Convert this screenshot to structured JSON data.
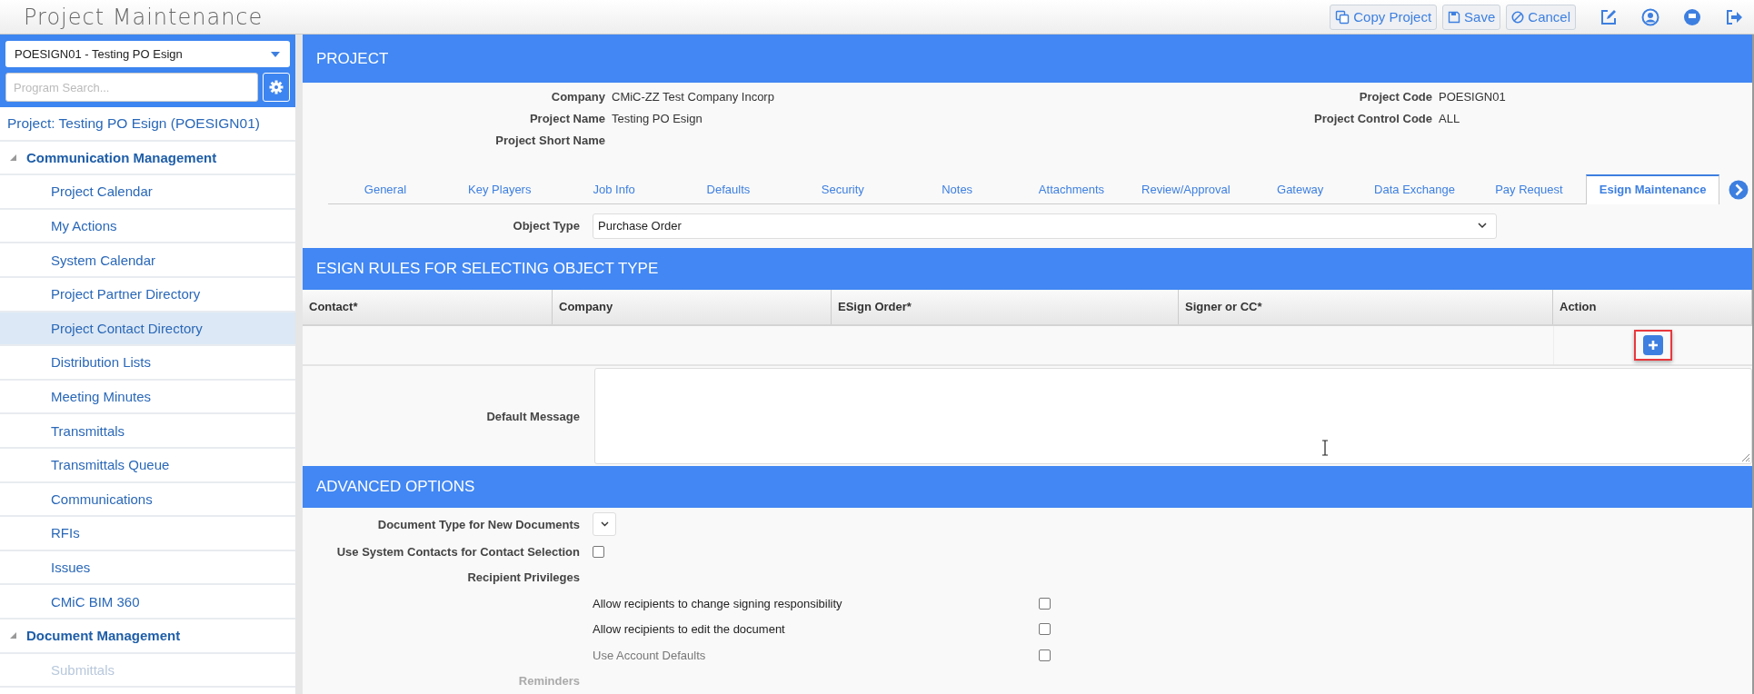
{
  "header": {
    "title": "Project Maintenance",
    "buttons": [
      "Copy Project",
      "Save",
      "Cancel"
    ]
  },
  "sidebar": {
    "project_select": "POESIGN01 - Testing PO Esign",
    "search_placeholder": "Program Search...",
    "project_link": "Project: Testing PO Esign (POESIGN01)",
    "sections": [
      {
        "label": "Communication Management",
        "expanded": true,
        "children": [
          {
            "label": "Project Calendar",
            "selected": false,
            "disabled": false
          },
          {
            "label": "My Actions",
            "selected": false,
            "disabled": false
          },
          {
            "label": "System Calendar",
            "selected": false,
            "disabled": false
          },
          {
            "label": "Project Partner Directory",
            "selected": false,
            "disabled": false
          },
          {
            "label": "Project Contact Directory",
            "selected": true,
            "disabled": false
          },
          {
            "label": "Distribution Lists",
            "selected": false,
            "disabled": false
          },
          {
            "label": "Meeting Minutes",
            "selected": false,
            "disabled": false
          },
          {
            "label": "Transmittals",
            "selected": false,
            "disabled": false
          },
          {
            "label": "Transmittals Queue",
            "selected": false,
            "disabled": false
          },
          {
            "label": "Communications",
            "selected": false,
            "disabled": false
          },
          {
            "label": "RFIs",
            "selected": false,
            "disabled": false
          },
          {
            "label": "Issues",
            "selected": false,
            "disabled": false
          },
          {
            "label": "CMiC BIM 360",
            "selected": false,
            "disabled": false
          }
        ]
      },
      {
        "label": "Document Management",
        "expanded": true,
        "children": [
          {
            "label": "Submittals",
            "selected": false,
            "disabled": true
          }
        ]
      }
    ]
  },
  "project": {
    "title": "PROJECT",
    "fields_left": [
      {
        "label": "Company",
        "value": "CMiC-ZZ Test Company Incorp"
      },
      {
        "label": "Project Name",
        "value": "Testing PO Esign"
      },
      {
        "label": "Project Short Name"
      }
    ],
    "fields_right": [
      {
        "label": "Project Code",
        "value": "POESIGN01"
      },
      {
        "label": "Project Control Code",
        "value": "ALL"
      }
    ]
  },
  "tabs": [
    {
      "label": "General",
      "selected": false
    },
    {
      "label": "Key Players",
      "selected": false
    },
    {
      "label": "Job Info",
      "selected": false
    },
    {
      "label": "Defaults",
      "selected": false
    },
    {
      "label": "Security",
      "selected": false
    },
    {
      "label": "Notes",
      "selected": false
    },
    {
      "label": "Attachments",
      "selected": false
    },
    {
      "label": "Review/Approval",
      "selected": false
    },
    {
      "label": "Gateway",
      "selected": false
    },
    {
      "label": "Data Exchange",
      "selected": false
    },
    {
      "label": "Pay Request",
      "selected": false
    },
    {
      "label": "Esign Maintenance",
      "selected": true
    }
  ],
  "object_type": {
    "label": "Object Type",
    "value": "Purchase Order"
  },
  "esign_rules": {
    "title": "ESIGN RULES FOR SELECTING OBJECT TYPE",
    "columns": [
      "Contact*",
      "Company",
      "ESign Order*",
      "Signer or CC*",
      "Action"
    ],
    "add_button": {
      "highlighted": true
    }
  },
  "default_message": {
    "label": "Default Message"
  },
  "advanced": {
    "title": "ADVANCED OPTIONS",
    "options": [
      {
        "kind": "select",
        "label": "Document Type for New Documents",
        "disabled": false
      },
      {
        "kind": "checkbox",
        "label": "Use System Contacts for Contact Selection",
        "checked": false,
        "disabled": false
      },
      {
        "kind": "heading",
        "label": "Recipient Privileges",
        "disabled": false
      },
      {
        "kind": "sub_checkbox",
        "label": "Allow recipients to change signing responsibility",
        "checked": false,
        "disabled": false
      },
      {
        "kind": "sub_checkbox",
        "label": "Allow recipients to edit the document",
        "checked": false,
        "disabled": false
      },
      {
        "kind": "sub_checkbox",
        "label": "Use Account Defaults",
        "checked": false,
        "disabled": true
      },
      {
        "kind": "heading",
        "label": "Reminders",
        "disabled": true
      }
    ]
  }
}
